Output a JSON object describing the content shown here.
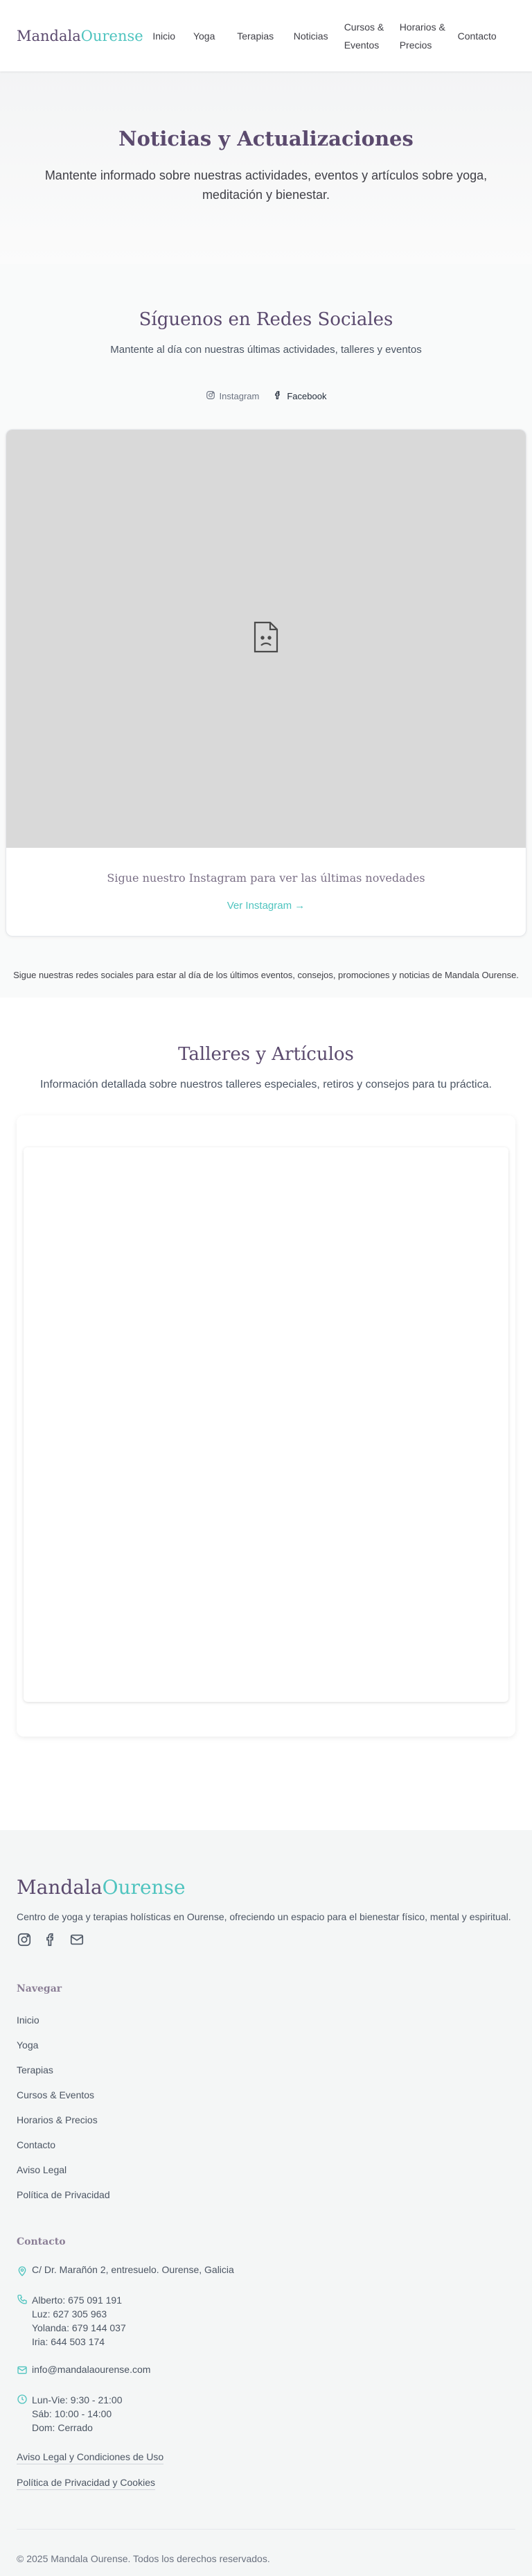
{
  "brand": {
    "part1": "Mandala",
    "part2": "Ourense"
  },
  "nav": {
    "items": [
      "Inicio",
      "Yoga",
      "Terapias",
      "Noticias",
      "Cursos & Eventos",
      "Horarios & Precios",
      "Contacto"
    ]
  },
  "hero": {
    "title": "Noticias y Actualizaciones",
    "subtitle": "Mantente informado sobre nuestras actividades, eventos y artículos sobre yoga, meditación y bienestar."
  },
  "social": {
    "title": "Síguenos en Redes Sociales",
    "subtitle": "Mantente al día con nuestras últimas actividades, talleres y eventos",
    "tabs": [
      "Instagram",
      "Facebook"
    ],
    "card_text": "Sigue nuestro Instagram para ver las últimas novedades",
    "card_link": "Ver Instagram",
    "note": "Sigue nuestras redes sociales para estar al día de los últimos eventos, consejos, promociones y noticias de Mandala Ourense."
  },
  "workshops": {
    "title": "Talleres y Artículos",
    "subtitle": "Información detallada sobre nuestros talleres especiales, retiros y consejos para tu práctica."
  },
  "footer": {
    "description": "Centro de yoga y terapias holísticas en Ourense, ofreciendo un espacio para el bienestar físico, mental y espiritual.",
    "nav_heading": "Navegar",
    "nav_links": [
      "Inicio",
      "Yoga",
      "Terapias",
      "Cursos & Eventos",
      "Horarios & Precios",
      "Contacto",
      "Aviso Legal",
      "Política de Privacidad"
    ],
    "contact_heading": "Contacto",
    "address": "C/ Dr. Marañón 2, entresuelo. Ourense, Galicia",
    "phones": [
      "Alberto: 675 091 191",
      "Luz: 627 305 963",
      "Yolanda: 679 144 037",
      "Iria: 644 503 174"
    ],
    "email": "info@mandalaourense.com",
    "hours": [
      "Lun-Vie: 9:30 - 21:00",
      "Sáb: 10:00 - 14:00",
      "Dom: Cerrado"
    ],
    "legal_links": [
      "Aviso Legal y Condiciones de Uso",
      "Política de Privacidad y Cookies"
    ],
    "copyright": "© 2025 Mandala Ourense. Todos los derechos reservados."
  },
  "icons": {
    "instagram": "instagram-icon",
    "facebook": "facebook-icon",
    "mail": "mail-icon",
    "location": "map-pin-icon",
    "phone": "phone-icon",
    "clock": "clock-icon",
    "broken_image": "broken-image-icon",
    "arrow": "arrow-right-icon"
  },
  "colors": {
    "primary": "#5b4a6e",
    "accent": "#4fc4bf",
    "frame": "#d9d9d9"
  }
}
